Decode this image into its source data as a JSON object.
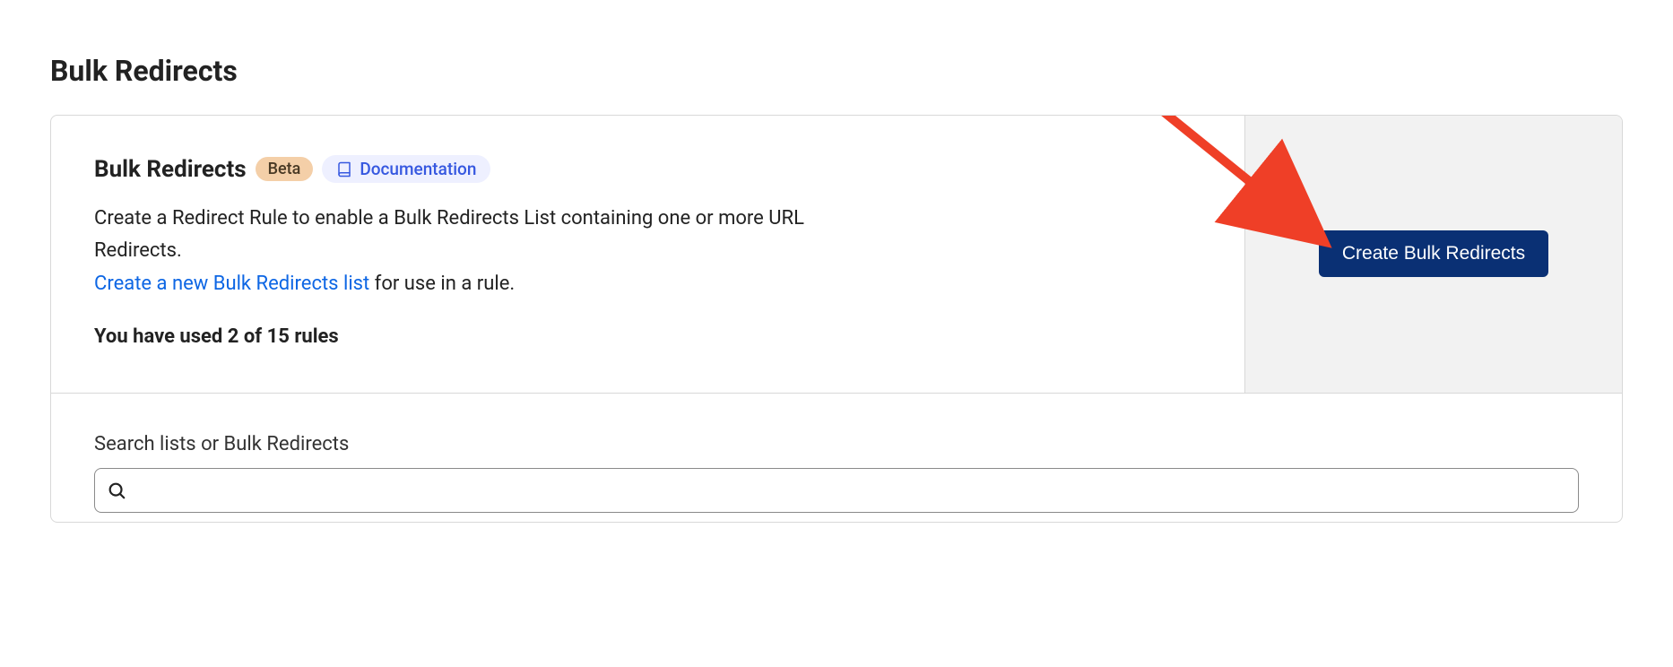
{
  "page": {
    "title": "Bulk Redirects"
  },
  "header": {
    "subtitle": "Bulk Redirects",
    "beta_label": "Beta",
    "documentation_label": "Documentation"
  },
  "description": {
    "text": "Create a Redirect Rule to enable a Bulk Redirects List containing one or more URL Redirects.",
    "link_text": "Create a new Bulk Redirects list",
    "link_trailing": " for use in a rule."
  },
  "usage": {
    "text": "You have used 2 of 15 rules"
  },
  "actions": {
    "create_label": "Create Bulk Redirects"
  },
  "search": {
    "label": "Search lists or Bulk Redirects",
    "placeholder": ""
  }
}
